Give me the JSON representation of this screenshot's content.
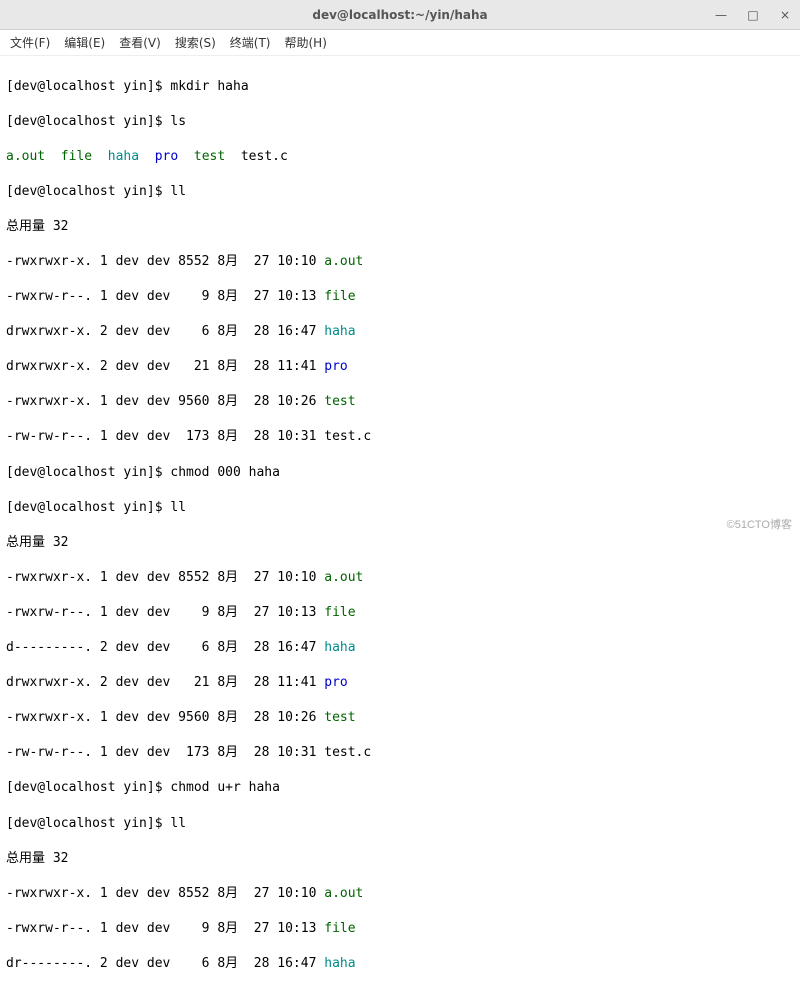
{
  "window": {
    "title": "dev@localhost:~/yin/haha",
    "controls": {
      "min": "—",
      "max": "□",
      "close": "×"
    }
  },
  "menubar": {
    "file": "文件(F)",
    "edit": "编辑(E)",
    "view": "查看(V)",
    "search": "搜索(S)",
    "terminal": "终端(T)",
    "help": "帮助(H)"
  },
  "prompt": {
    "p1": "[dev@localhost yin]$ "
  },
  "cmds": {
    "mkdir": "mkdir haha",
    "ls": "ls",
    "ll1": "ll",
    "chmod000": "chmod 000 haha",
    "ll2": "ll",
    "chmodur": "chmod u+r haha",
    "ll3": "ll"
  },
  "ls_output": {
    "aout": "a.out",
    "sep1": "  ",
    "file": "file",
    "sep2": "  ",
    "haha": "haha",
    "sep3": "  ",
    "pro": "pro",
    "sep4": "  ",
    "test": "test",
    "sep5": "  ",
    "testc": "test.c"
  },
  "total": "总用量 32",
  "ll1": {
    "r0": {
      "left": "-rwxrwxr-x. 1 dev dev 8552 8月  27 10:10 ",
      "name": "a.out"
    },
    "r1": {
      "left": "-rwxrw-r--. 1 dev dev    9 8月  27 10:13 ",
      "name": "file"
    },
    "r2": {
      "left": "drwxrwxr-x. 2 dev dev    6 8月  28 16:47 ",
      "name": "haha"
    },
    "r3": {
      "left": "drwxrwxr-x. 2 dev dev   21 8月  28 11:41 ",
      "name": "pro"
    },
    "r4": {
      "left": "-rwxrwxr-x. 1 dev dev 9560 8月  28 10:26 ",
      "name": "test"
    },
    "r5": {
      "left": "-rw-rw-r--. 1 dev dev  173 8月  28 10:31 test.c"
    }
  },
  "ll2": {
    "r0": {
      "left": "-rwxrwxr-x. 1 dev dev 8552 8月  27 10:10 ",
      "name": "a.out"
    },
    "r1": {
      "left": "-rwxrw-r--. 1 dev dev    9 8月  27 10:13 ",
      "name": "file"
    },
    "r2": {
      "left": "d---------. 2 dev dev    6 8月  28 16:47 ",
      "name": "haha"
    },
    "r3": {
      "left": "drwxrwxr-x. 2 dev dev   21 8月  28 11:41 ",
      "name": "pro"
    },
    "r4": {
      "left": "-rwxrwxr-x. 1 dev dev 9560 8月  28 10:26 ",
      "name": "test"
    },
    "r5": {
      "left": "-rw-rw-r--. 1 dev dev  173 8月  28 10:31 test.c"
    }
  },
  "ll3": {
    "r0": {
      "left": "-rwxrwxr-x. 1 dev dev 8552 8月  27 10:10 ",
      "name": "a.out"
    },
    "r1": {
      "left": "-rwxrw-r--. 1 dev dev    9 8月  27 10:13 ",
      "name": "file"
    },
    "r2": {
      "left": "dr--------. 2 dev dev    6 8月  28 16:47 ",
      "name": "haha"
    }
  },
  "watermark": "©51CTO博客"
}
